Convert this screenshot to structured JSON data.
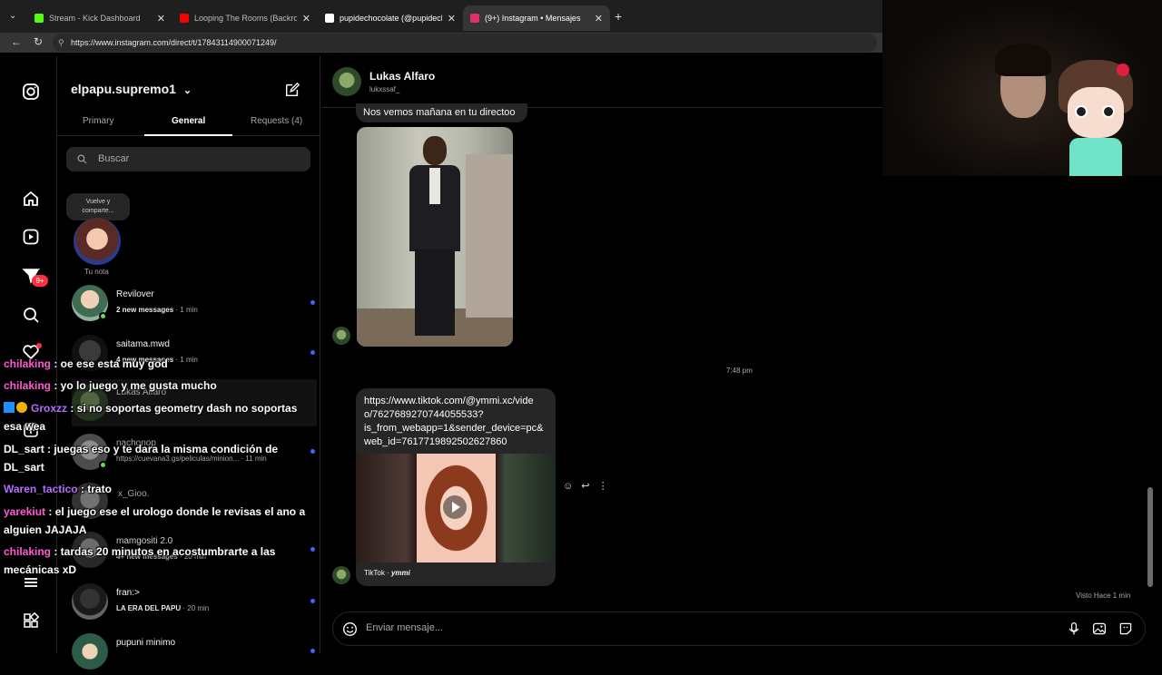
{
  "browser": {
    "tabs": [
      {
        "title": "Stream - Kick Dashboard",
        "color": "#53fc18"
      },
      {
        "title": "Looping The Rooms (Backrooms L",
        "color": "#ff0000"
      },
      {
        "title": "pupidechocolate (@pupidechocola",
        "color": "#ffffff"
      },
      {
        "title": "(9+) Instagram • Mensajes",
        "color": "#e1306c"
      }
    ],
    "url": "https://www.instagram.com/direct/t/17843114900071249/"
  },
  "rail": {
    "badge": "9+"
  },
  "inbox": {
    "username": "elpapu.supremo1",
    "tabs": [
      "Primary",
      "General",
      "Requests (4)"
    ],
    "active_tab": "General",
    "search_placeholder": "Buscar",
    "note_bubble": "Vuelve y comparte...",
    "note_label": "Tu nota",
    "threads": [
      {
        "name": "Revilover",
        "preview": "2 new messages",
        "time": "· 1 min"
      },
      {
        "name": "saitama.mwd",
        "preview": "4 new messages",
        "time": "· 1 min"
      },
      {
        "name": "Lukas Alfaro",
        "preview": "",
        "time": ""
      },
      {
        "name": "nachonop",
        "preview": "https://cuevana3.gs/peliculas/minion...",
        "time": "· 11 min"
      },
      {
        "name": "x_Gioo.",
        "preview": "",
        "time": ""
      },
      {
        "name": "mamgositi 2.0",
        "preview": "4+ new messages",
        "time": "· 20 min"
      },
      {
        "name": "fran:>",
        "preview": "LA ERA DEL PAPU",
        "time": "· 20 min"
      },
      {
        "name": "pupuni minimo",
        "preview": "",
        "time": ""
      }
    ]
  },
  "conversation": {
    "name": "Lukas Alfaro",
    "handle": "lukxssaf_",
    "message_text": "Nos vemos mañana en tu directoo",
    "timestamp": "7:48 pm",
    "link_text": "https://www.tiktok.com/@ymmi.xc/video/7627689270744055533?is_from_webapp=1&sender_device=pc&web_id=7617719892502627860",
    "link_lines": [
      "https://www.tiktok.com/@ymmi.xc/vide",
      "o/7627689270744055533?",
      "is_from_webapp=1&sender_device=pc&",
      "web_id=7617719892502627860"
    ],
    "tiktok_label": "TikTok · ",
    "tiktok_user": "ymmi",
    "seen": "Visto Hace 1 min",
    "composer_placeholder": "Enviar mensaje..."
  },
  "chat_overlay": [
    {
      "user": "chilaking",
      "text": " : oe ese esta muy god",
      "color": "#ff5ad2"
    },
    {
      "user": "chilaking",
      "text": " : yo lo juego y me gusta mucho",
      "color": "#ff5ad2"
    },
    {
      "user": "Groxzz",
      "text": " : si no soportas geometry dash no soportas esa wea",
      "color": "#b56cff"
    },
    {
      "user": "DL_sart",
      "text": " : juegas eso y te dara la misma condición de DL_sart",
      "color": "#ffffff"
    },
    {
      "user": "Waren_tactico",
      "text": " : trato",
      "color": "#b56cff"
    },
    {
      "user": "yarekiut",
      "text": " : el juego ese el urologo donde le revisas el ano a alguien JAJAJA",
      "color": "#ff5ad2"
    },
    {
      "user": "chilaking",
      "text": " : tardas 20 minutos en acostumbrarte a las mecánicas xD",
      "color": "#ff5ad2"
    }
  ]
}
